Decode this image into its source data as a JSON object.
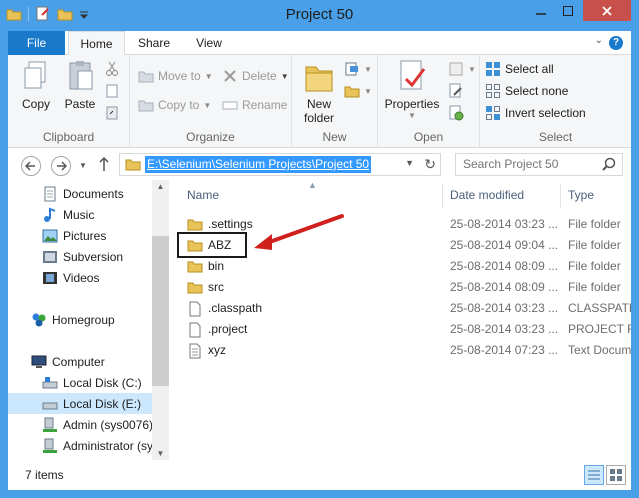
{
  "window": {
    "title": "Project 50"
  },
  "ribbon": {
    "tabs": [
      "File",
      "Home",
      "Share",
      "View"
    ],
    "clipboard": {
      "label": "Clipboard",
      "copy": "Copy",
      "paste": "Paste"
    },
    "organize": {
      "label": "Organize",
      "move_to": "Move to",
      "copy_to": "Copy to",
      "delete": "Delete",
      "rename": "Rename"
    },
    "new": {
      "label": "New",
      "new_folder_line1": "New",
      "new_folder_line2": "folder"
    },
    "open": {
      "label": "Open",
      "properties": "Properties"
    },
    "select": {
      "label": "Select",
      "select_all": "Select all",
      "select_none": "Select none",
      "invert": "Invert selection"
    }
  },
  "address": {
    "path": "E:\\Selenium\\Selenium Projects\\Project 50",
    "search_placeholder": "Search Project 50"
  },
  "nav_pane": {
    "items": [
      {
        "label": "Documents",
        "icon": "documents-icon"
      },
      {
        "label": "Music",
        "icon": "music-icon"
      },
      {
        "label": "Pictures",
        "icon": "pictures-icon"
      },
      {
        "label": "Subversion",
        "icon": "subversion-icon"
      },
      {
        "label": "Videos",
        "icon": "videos-icon"
      },
      {
        "label": "Homegroup",
        "icon": "homegroup-icon"
      },
      {
        "label": "Computer",
        "icon": "computer-icon"
      },
      {
        "label": "Local Disk (C:)",
        "icon": "disk-icon"
      },
      {
        "label": "Local Disk (E:)",
        "icon": "disk-icon",
        "selected": true
      },
      {
        "label": "Admin (sys0076)",
        "icon": "network-drive-icon"
      },
      {
        "label": "Administrator (sy",
        "icon": "network-drive-icon"
      }
    ]
  },
  "columns": {
    "name": "Name",
    "date": "Date modified",
    "type": "Type"
  },
  "files": [
    {
      "name": ".settings",
      "date": "25-08-2014 03:23 ...",
      "type": "File folder",
      "kind": "folder"
    },
    {
      "name": "ABZ",
      "date": "25-08-2014 09:04 ...",
      "type": "File folder",
      "kind": "folder"
    },
    {
      "name": "bin",
      "date": "25-08-2014 08:09 ...",
      "type": "File folder",
      "kind": "folder"
    },
    {
      "name": "src",
      "date": "25-08-2014 08:09 ...",
      "type": "File folder",
      "kind": "folder"
    },
    {
      "name": ".classpath",
      "date": "25-08-2014 03:23 ...",
      "type": "CLASSPATH",
      "kind": "file"
    },
    {
      "name": ".project",
      "date": "25-08-2014 03:23 ...",
      "type": "PROJECT Fi",
      "kind": "file"
    },
    {
      "name": "xyz",
      "date": "25-08-2014 07:23 ...",
      "type": "Text Docum",
      "kind": "text"
    }
  ],
  "status": {
    "count": "7 items"
  },
  "colors": {
    "accent": "#1979ca",
    "frame": "#4aa0e8",
    "close": "#c7504a",
    "selection": "#cce8ff",
    "annotation_arrow": "#d0201d"
  }
}
